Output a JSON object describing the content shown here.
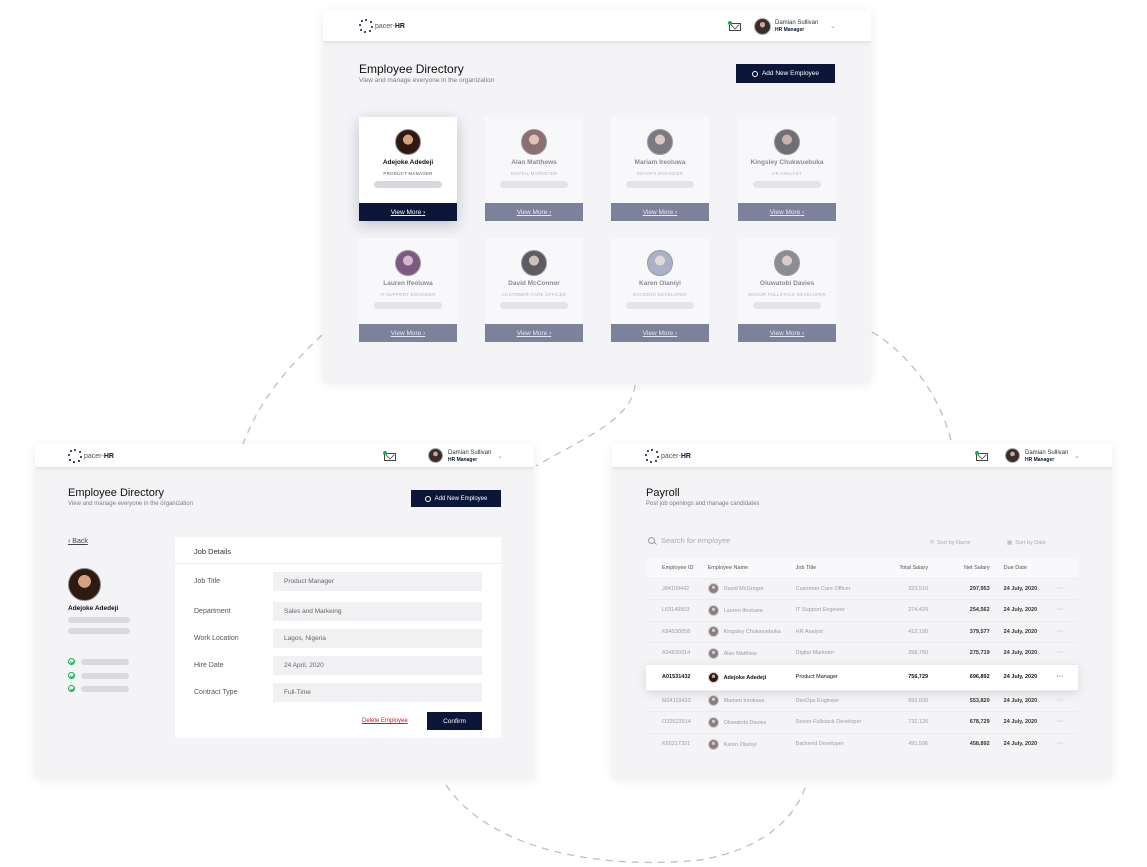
{
  "brand": {
    "logo_prefix": "pacer-",
    "logo_suffix": "HR"
  },
  "user": {
    "name": "Damian Sullivan",
    "role": "HR Manager"
  },
  "directory": {
    "title": "Employee Directory",
    "subtitle": "View and manage everyone in the organization",
    "add_button": "Add New Employee",
    "view_more": "View More",
    "employees": [
      {
        "name": "Adejoke Adedeji",
        "role": "PRODUCT MANAGER"
      },
      {
        "name": "Alan Matthews",
        "role": "DIGITAL MARKETER"
      },
      {
        "name": "Mariam Ireoluwa",
        "role": "DEVOPS ENGINEER"
      },
      {
        "name": "Kingsley Chukwuebuka",
        "role": "HR ANALYST"
      },
      {
        "name": "Lauren Ifeoluwa",
        "role": "IT SUPPORT ENGINEER"
      },
      {
        "name": "David McConnor",
        "role": "CUSTOMER CARE OFFICER"
      },
      {
        "name": "Karen Olaniyi",
        "role": "BACKEND DEVELOPER"
      },
      {
        "name": "Oluwatobi Davies",
        "role": "SENIOR FULLSTACK DEVELOPER"
      }
    ]
  },
  "details": {
    "title": "Employee Directory",
    "subtitle": "View and manage everyone in the organization",
    "add_button": "Add New Employee",
    "back": "Back",
    "employee_name": "Adejoke Adedeji",
    "panel_title": "Job Details",
    "fields": [
      {
        "label": "Job Title",
        "value": "Product Manager"
      },
      {
        "label": "Department",
        "value": "Sales and Markeing"
      },
      {
        "label": "Work Location",
        "value": "Lagos, Nigeria"
      },
      {
        "label": "Hire Date",
        "value": "24 April, 2020"
      },
      {
        "label": "Contract Type",
        "value": "Full-Time"
      }
    ],
    "delete_label": "Delete Employee",
    "confirm_label": "Confirm"
  },
  "payroll": {
    "title": "Payroll",
    "subtitle": "Post job openings and manage candidates",
    "search_placeholder": "Search for employee",
    "sort_name": "Sort by Name",
    "sort_date": "Sort by Date",
    "columns": [
      "Employee ID",
      "Employee Name",
      "Job Title",
      "Total Salary",
      "Net Salary",
      "Due Date"
    ],
    "rows": [
      {
        "id": "J84109442",
        "name": "David McGregor",
        "title": "Customer Care Officer",
        "total": "323,510",
        "net": "297,953",
        "due": "24 July, 2020"
      },
      {
        "id": "L63149503",
        "name": "Lauren Ifeoluwa",
        "title": "IT Support Engineer",
        "total": "274,429",
        "net": "254,562",
        "due": "24 July, 2020"
      },
      {
        "id": "K84530058",
        "name": "Kingsley Chukwuebuka",
        "title": "HR Analyst",
        "total": "412,190",
        "net": "379,577",
        "due": "24 July, 2020"
      },
      {
        "id": "A34630314",
        "name": "Alan Matthew",
        "title": "Digital Marketer",
        "total": "298,750",
        "net": "275,719",
        "due": "24 July, 2020"
      },
      {
        "id": "A01531432",
        "name": "Adejoke Adedeji",
        "title": "Product Manager",
        "total": "756,729",
        "net": "696,892",
        "due": "24 July, 2020"
      },
      {
        "id": "M24119433",
        "name": "Mariam Ireoluwa",
        "title": "DevOps Engineer",
        "total": "592,600",
        "net": "553,820",
        "due": "24 July, 2020"
      },
      {
        "id": "O32623914",
        "name": "Oluwatobi Davies",
        "title": "Senior Fullstack Developer",
        "total": "732,126",
        "net": "678,729",
        "due": "24 July, 2020"
      },
      {
        "id": "K65217321",
        "name": "Karen Olaniyi",
        "title": "Backend Developer",
        "total": "491,506",
        "net": "458,892",
        "due": "24 July, 2020"
      }
    ],
    "more_glyph": "···"
  },
  "colors": {
    "navy": "#0b1638",
    "muted_button": "#7c8299",
    "notify_green": "#1aaf4b",
    "delete_red": "#c01f1f"
  }
}
